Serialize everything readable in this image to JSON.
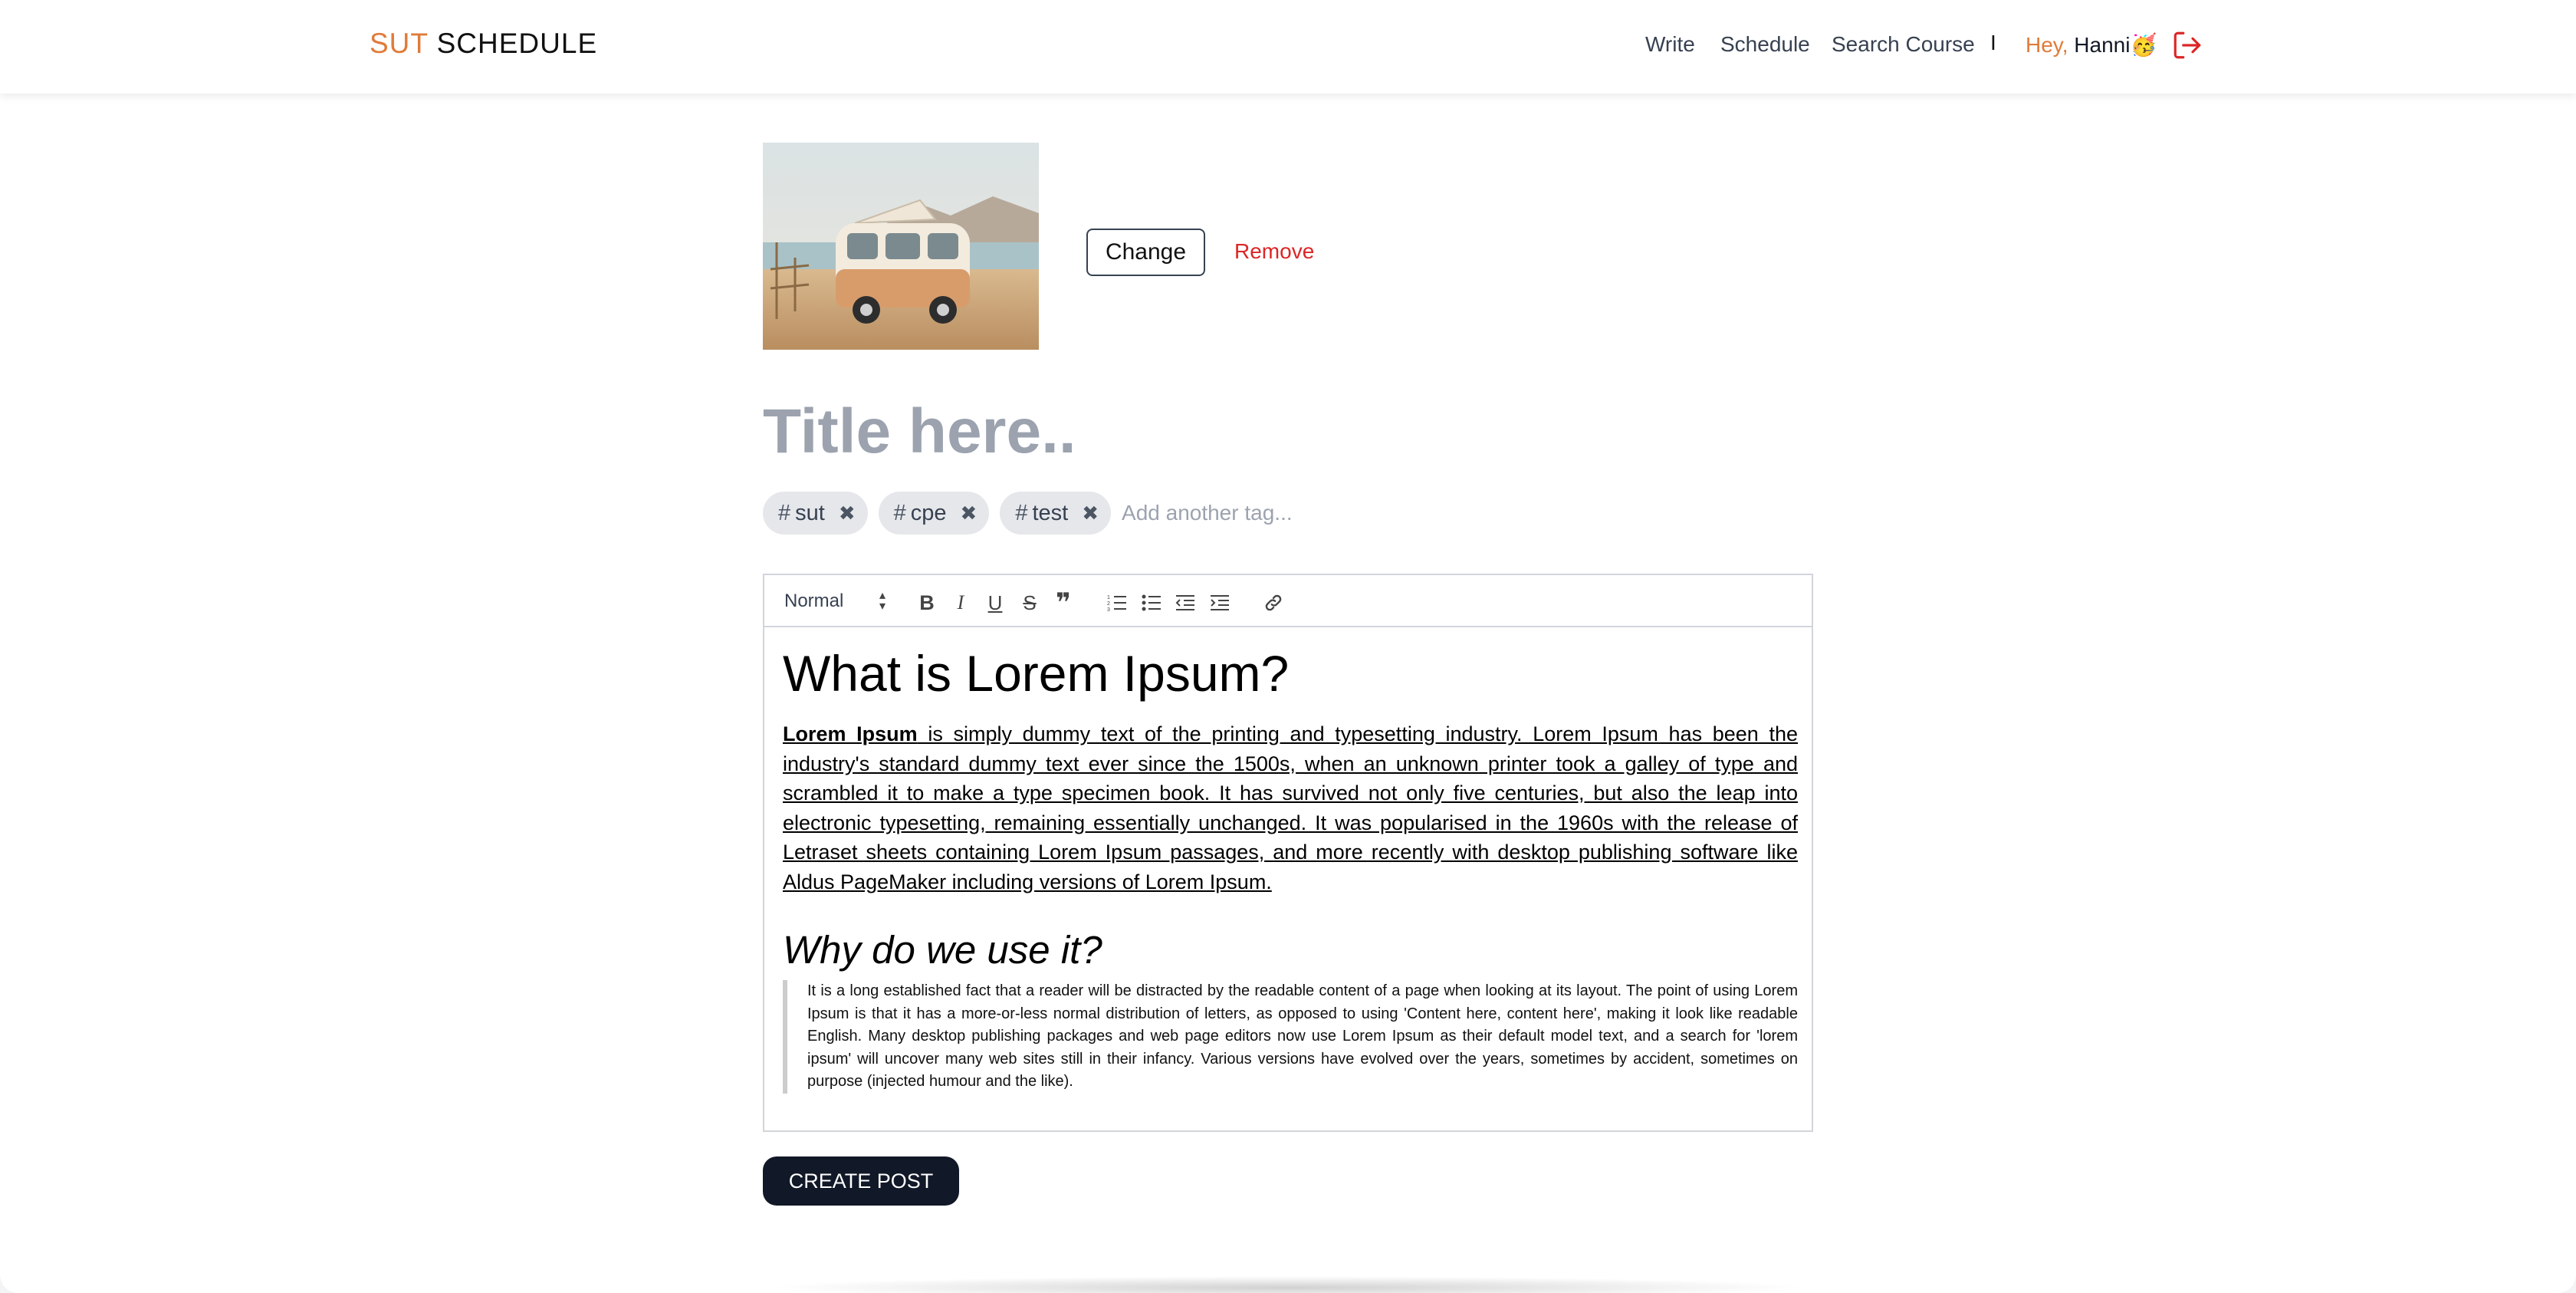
{
  "nav": {
    "brand_part1": "SUT",
    "brand_part2": "SCHEDULE",
    "links": [
      "Write",
      "Schedule",
      "Search Course"
    ],
    "separator": "I",
    "greeting_hey": "Hey,",
    "greeting_name": "Hanni🥳",
    "accent_color": "#e07b39"
  },
  "cover": {
    "change_label": "Change",
    "remove_label": "Remove"
  },
  "post": {
    "title_placeholder": "Title here..",
    "tags": [
      "sut",
      "cpe",
      "test"
    ],
    "tag_placeholder": "Add another tag..."
  },
  "editor": {
    "block_format": "Normal",
    "toolbar_icons": [
      "bold-icon",
      "italic-icon",
      "underline-icon",
      "strike-icon",
      "quote-icon",
      "ordered-list-icon",
      "bullet-list-icon",
      "outdent-icon",
      "indent-icon",
      "link-icon"
    ],
    "heading1": "What is Lorem Ipsum?",
    "para1_bold": "Lorem Ipsum",
    "para1_rest": " is simply dummy text of the printing and typesetting industry. Lorem Ipsum has been the industry's standard dummy text ever since the 1500s, when an unknown printer took a galley of type and scrambled it to make a type specimen book. It has survived not only five centuries, but also the leap into electronic typesetting, remaining essentially unchanged. It was popularised in the 1960s with the release of Letraset sheets containing Lorem Ipsum passages, and more recently with desktop publishing software like Aldus PageMaker including versions of Lorem Ipsum.",
    "heading2": "Why do we use it?",
    "quote": "It is a long established fact that a reader will be distracted by the readable content of a page when looking at its layout. The point of using Lorem Ipsum is that it has a more-or-less normal distribution of letters, as opposed to using 'Content here, content here', making it look like readable English. Many desktop publishing packages and web page editors now use Lorem Ipsum as their default model text, and a search for 'lorem ipsum' will uncover many web sites still in their infancy. Various versions have evolved over the years, sometimes by accident, sometimes on purpose (injected humour and the like)."
  },
  "actions": {
    "create_label": "CREATE POST"
  }
}
